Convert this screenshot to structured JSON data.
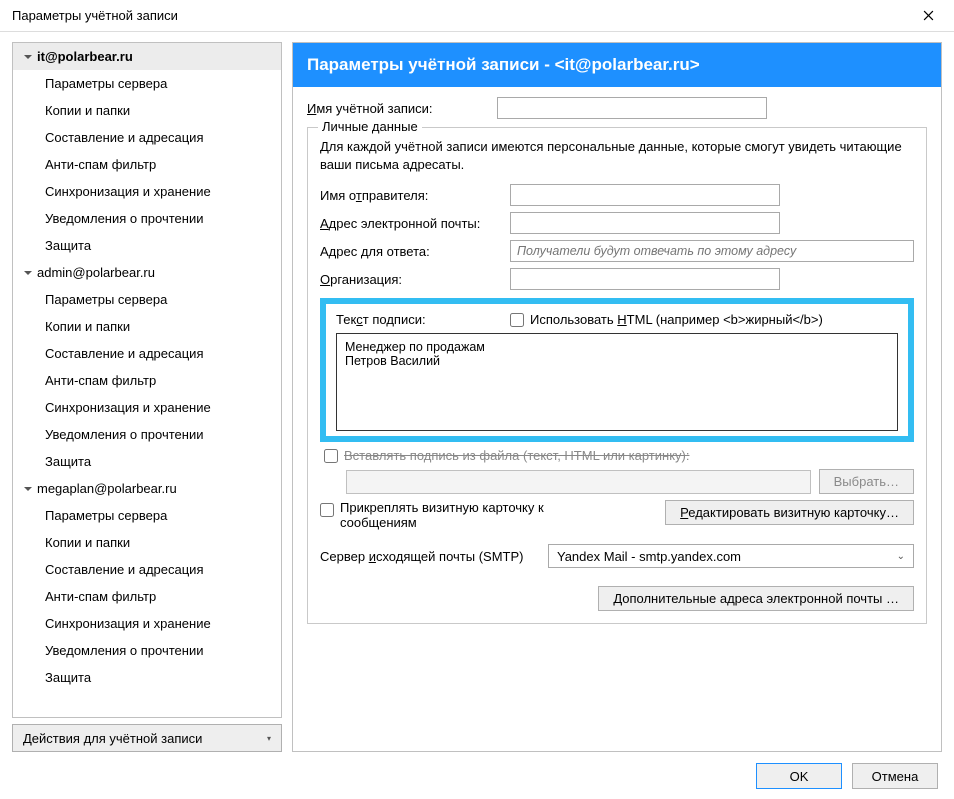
{
  "window": {
    "title": "Параметры учётной записи",
    "close_icon": "close-icon"
  },
  "banner": {
    "prefix": "Параметры учётной записи - ",
    "account": "<it@polarbear.ru>"
  },
  "sidebar": {
    "accounts": [
      {
        "name": "it@polarbear.ru",
        "selected": true,
        "items": [
          "Параметры сервера",
          "Копии и папки",
          "Составление и адресация",
          "Анти-спам фильтр",
          "Синхронизация и хранение",
          "Уведомления о прочтении",
          "Защита"
        ]
      },
      {
        "name": "admin@polarbear.ru",
        "selected": false,
        "items": [
          "Параметры сервера",
          "Копии и папки",
          "Составление и адресация",
          "Анти-спам фильтр",
          "Синхронизация и хранение",
          "Уведомления о прочтении",
          "Защита"
        ]
      },
      {
        "name": "megaplan@polarbear.ru",
        "selected": false,
        "items": [
          "Параметры сервера",
          "Копии и папки",
          "Составление и адресация",
          "Анти-спам фильтр",
          "Синхронизация и хранение",
          "Уведомления о прочтении",
          "Защита"
        ]
      }
    ],
    "actions_label": "Действия для учётной записи"
  },
  "form": {
    "account_name_label": "Имя учётной записи:",
    "account_name_value": "",
    "personal": {
      "legend": "Личные данные",
      "desc": "Для каждой учётной записи имеются персональные данные, которые смогут увидеть читающие ваши письма адресаты.",
      "sender_name_label": "Имя отправителя:",
      "sender_name_value": "",
      "email_label": "Адрес электронной почты:",
      "email_value": "",
      "reply_label": "Адрес для ответа:",
      "reply_placeholder": "Получатели будут отвечать по этому адресу",
      "org_label": "Организация:",
      "org_value": ""
    },
    "signature": {
      "label": "Текст подписи:",
      "html_checkbox_label": "Использовать HTML (например <b>жирный</b>)",
      "html_checked": false,
      "text": "Менеджер по продажам\nПетров Василий"
    },
    "attach_from_file": {
      "checkbox_label": "Вставлять подпись из файла (текст, HTML или картинку):",
      "checked": false,
      "browse_label": "Выбрать…"
    },
    "vcard": {
      "checkbox_label": "Прикреплять визитную карточку к сообщениям",
      "checked": false,
      "edit_button": "Редактировать визитную карточку…"
    },
    "smtp": {
      "label": "Сервер исходящей почты (SMTP)",
      "selected": "Yandex Mail - smtp.yandex.com"
    },
    "additional_button": "Дополнительные адреса электронной почты …"
  },
  "footer": {
    "ok": "OK",
    "cancel": "Отмена"
  }
}
